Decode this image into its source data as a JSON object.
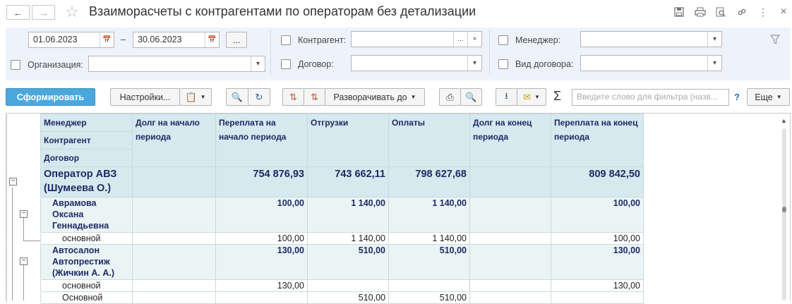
{
  "header": {
    "back_icon": "arrow-left-icon",
    "forward_icon": "arrow-right-icon",
    "favorite_icon": "star-icon",
    "title": "Взаиморасчеты с контрагентами по операторам без детализации",
    "actions": [
      "save-icon",
      "print-icon",
      "preview-icon",
      "link-icon",
      "more-icon",
      "close-icon"
    ]
  },
  "filters": {
    "date_from": "01.06.2023",
    "date_separator": "–",
    "date_to": "30.06.2023",
    "period_button": "...",
    "organization_label": "Организация:",
    "counterparty_label": "Контрагент:",
    "counterparty_btn": "...",
    "counterparty_clear": "×",
    "contract_label": "Договор:",
    "manager_label": "Менеджер:",
    "contract_type_label": "Вид договора:"
  },
  "toolbar": {
    "generate": "Сформировать",
    "settings": "Настройки...",
    "expand_to": "Разворачивать до",
    "sigma": "Σ",
    "filter_placeholder": "Введите слово для фильтра (назв...",
    "help": "?",
    "more": "Еще"
  },
  "table": {
    "headers": {
      "group_lines": [
        "Менеджер",
        "Контрагент",
        "Договор"
      ],
      "debt_start": "Долг на начало периода",
      "overpay_start": "Переплата на начало периода",
      "shipments": "Отгрузки",
      "payments": "Оплаты",
      "debt_end": "Долг на конец периода",
      "overpay_end": "Переплата на конец периода"
    },
    "rows": [
      {
        "kind": "grp",
        "name": "Оператор АВЗ (Шумеева О.)",
        "debt_start": "",
        "overpay_start": "754 876,93",
        "shipments": "743 662,11",
        "payments": "798 627,68",
        "debt_end": "",
        "overpay_end": "809 842,50"
      },
      {
        "kind": "kon",
        "name": "Аврамова Оксана Геннадьевна",
        "debt_start": "",
        "overpay_start": "100,00",
        "shipments": "1 140,00",
        "payments": "1 140,00",
        "debt_end": "",
        "overpay_end": "100,00"
      },
      {
        "kind": "dog",
        "name": "основной",
        "debt_start": "",
        "overpay_start": "100,00",
        "shipments": "1 140,00",
        "payments": "1 140,00",
        "debt_end": "",
        "overpay_end": "100,00"
      },
      {
        "kind": "kon",
        "name": "Автосалон Автопрестиж (Жичкин А. А.)",
        "debt_start": "",
        "overpay_start": "130,00",
        "shipments": "510,00",
        "payments": "510,00",
        "debt_end": "",
        "overpay_end": "130,00"
      },
      {
        "kind": "dog",
        "name": "основной",
        "debt_start": "",
        "overpay_start": "130,00",
        "shipments": "",
        "payments": "",
        "debt_end": "",
        "overpay_end": "130,00"
      },
      {
        "kind": "dog",
        "name": "Основной",
        "debt_start": "",
        "overpay_start": "",
        "shipments": "510,00",
        "payments": "510,00",
        "debt_end": "",
        "overpay_end": ""
      }
    ]
  }
}
